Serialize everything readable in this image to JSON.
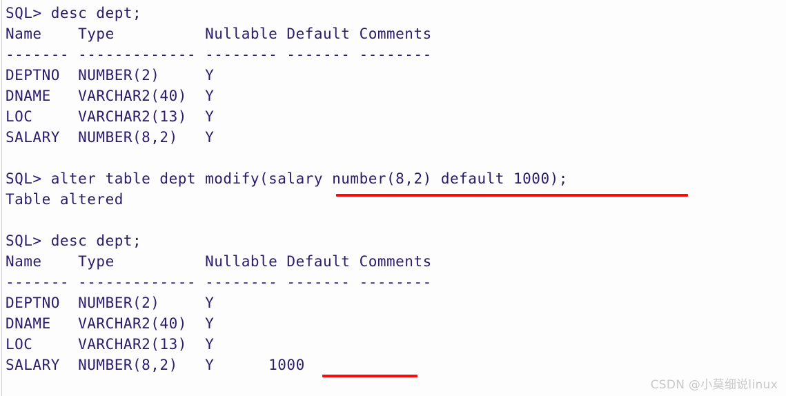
{
  "terminal": {
    "prompt": "SQL>",
    "text_color": "#2b1a6e",
    "background_color": "#fdfdfd",
    "lines": [
      "SQL> desc dept;",
      "Name    Type          Nullable Default Comments",
      "------- ------------- -------- ------- --------",
      "DEPTNO  NUMBER(2)     Y",
      "DNAME   VARCHAR2(40)  Y",
      "LOC     VARCHAR2(13)  Y",
      "SALARY  NUMBER(8,2)   Y",
      "",
      "SQL> alter table dept modify(salary number(8,2) default 1000);",
      "Table altered",
      "",
      "SQL> desc dept;",
      "Name    Type          Nullable Default Comments",
      "------- ------------- -------- ------- --------",
      "DEPTNO  NUMBER(2)     Y",
      "DNAME   VARCHAR2(40)  Y",
      "LOC     VARCHAR2(13)  Y",
      "SALARY  NUMBER(8,2)   Y      1000"
    ],
    "commands": [
      "desc dept;",
      "alter table dept modify(salary number(8,2) default 1000);",
      "desc dept;"
    ],
    "status_messages": [
      "Table altered"
    ],
    "describe_before": {
      "headers": [
        "Name",
        "Type",
        "Nullable",
        "Default",
        "Comments"
      ],
      "rows": [
        {
          "name": "DEPTNO",
          "type": "NUMBER(2)",
          "nullable": "Y",
          "default": "",
          "comments": ""
        },
        {
          "name": "DNAME",
          "type": "VARCHAR2(40)",
          "nullable": "Y",
          "default": "",
          "comments": ""
        },
        {
          "name": "LOC",
          "type": "VARCHAR2(13)",
          "nullable": "Y",
          "default": "",
          "comments": ""
        },
        {
          "name": "SALARY",
          "type": "NUMBER(8,2)",
          "nullable": "Y",
          "default": "",
          "comments": ""
        }
      ]
    },
    "describe_after": {
      "headers": [
        "Name",
        "Type",
        "Nullable",
        "Default",
        "Comments"
      ],
      "rows": [
        {
          "name": "DEPTNO",
          "type": "NUMBER(2)",
          "nullable": "Y",
          "default": "",
          "comments": ""
        },
        {
          "name": "DNAME",
          "type": "VARCHAR2(40)",
          "nullable": "Y",
          "default": "",
          "comments": ""
        },
        {
          "name": "LOC",
          "type": "VARCHAR2(13)",
          "nullable": "Y",
          "default": "",
          "comments": ""
        },
        {
          "name": "SALARY",
          "type": "NUMBER(8,2)",
          "nullable": "Y",
          "default": "1000",
          "comments": ""
        }
      ]
    }
  },
  "annotations": {
    "color": "#fb0a0a",
    "underlines": [
      {
        "target": "modify-clause",
        "covers": "salary number(8,2) default 1000);"
      },
      {
        "target": "default-value",
        "covers": "1000"
      }
    ]
  },
  "watermark": {
    "text": "CSDN @小莫细说linux",
    "color": "#c9c9c9"
  }
}
